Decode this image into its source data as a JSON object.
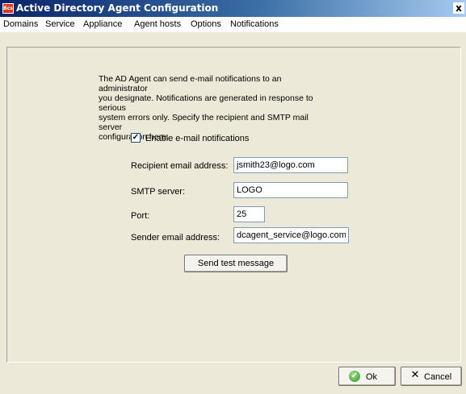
{
  "window": {
    "title": "Active Directory Agent Configuration",
    "app_icon_text": "Bcs",
    "close_glyph": "x"
  },
  "menu": {
    "items": [
      "Domains",
      "Service",
      "Appliance",
      "Agent hosts",
      "Options",
      "Notifications"
    ]
  },
  "notifications": {
    "description_lines": [
      "The AD Agent can send e-mail notifications to an administrator",
      "you designate.  Notifications are generated in response to serious",
      "system errors only.   Specify the recipient and SMTP mail server",
      "configuration here."
    ],
    "enable_label": "Enable e-mail notifications",
    "enable_checked": true,
    "recipient_label": "Recipient email address:",
    "recipient_value": "jsmith23@logo.com",
    "smtp_label": "SMTP server:",
    "smtp_value": "LOGO",
    "port_label": "Port:",
    "port_value": "25",
    "sender_label": "Sender email address:",
    "sender_value": "dcagent_service@logo.com",
    "test_button": "Send test message"
  },
  "footer": {
    "ok_label": "Ok",
    "cancel_label": "Cancel"
  }
}
